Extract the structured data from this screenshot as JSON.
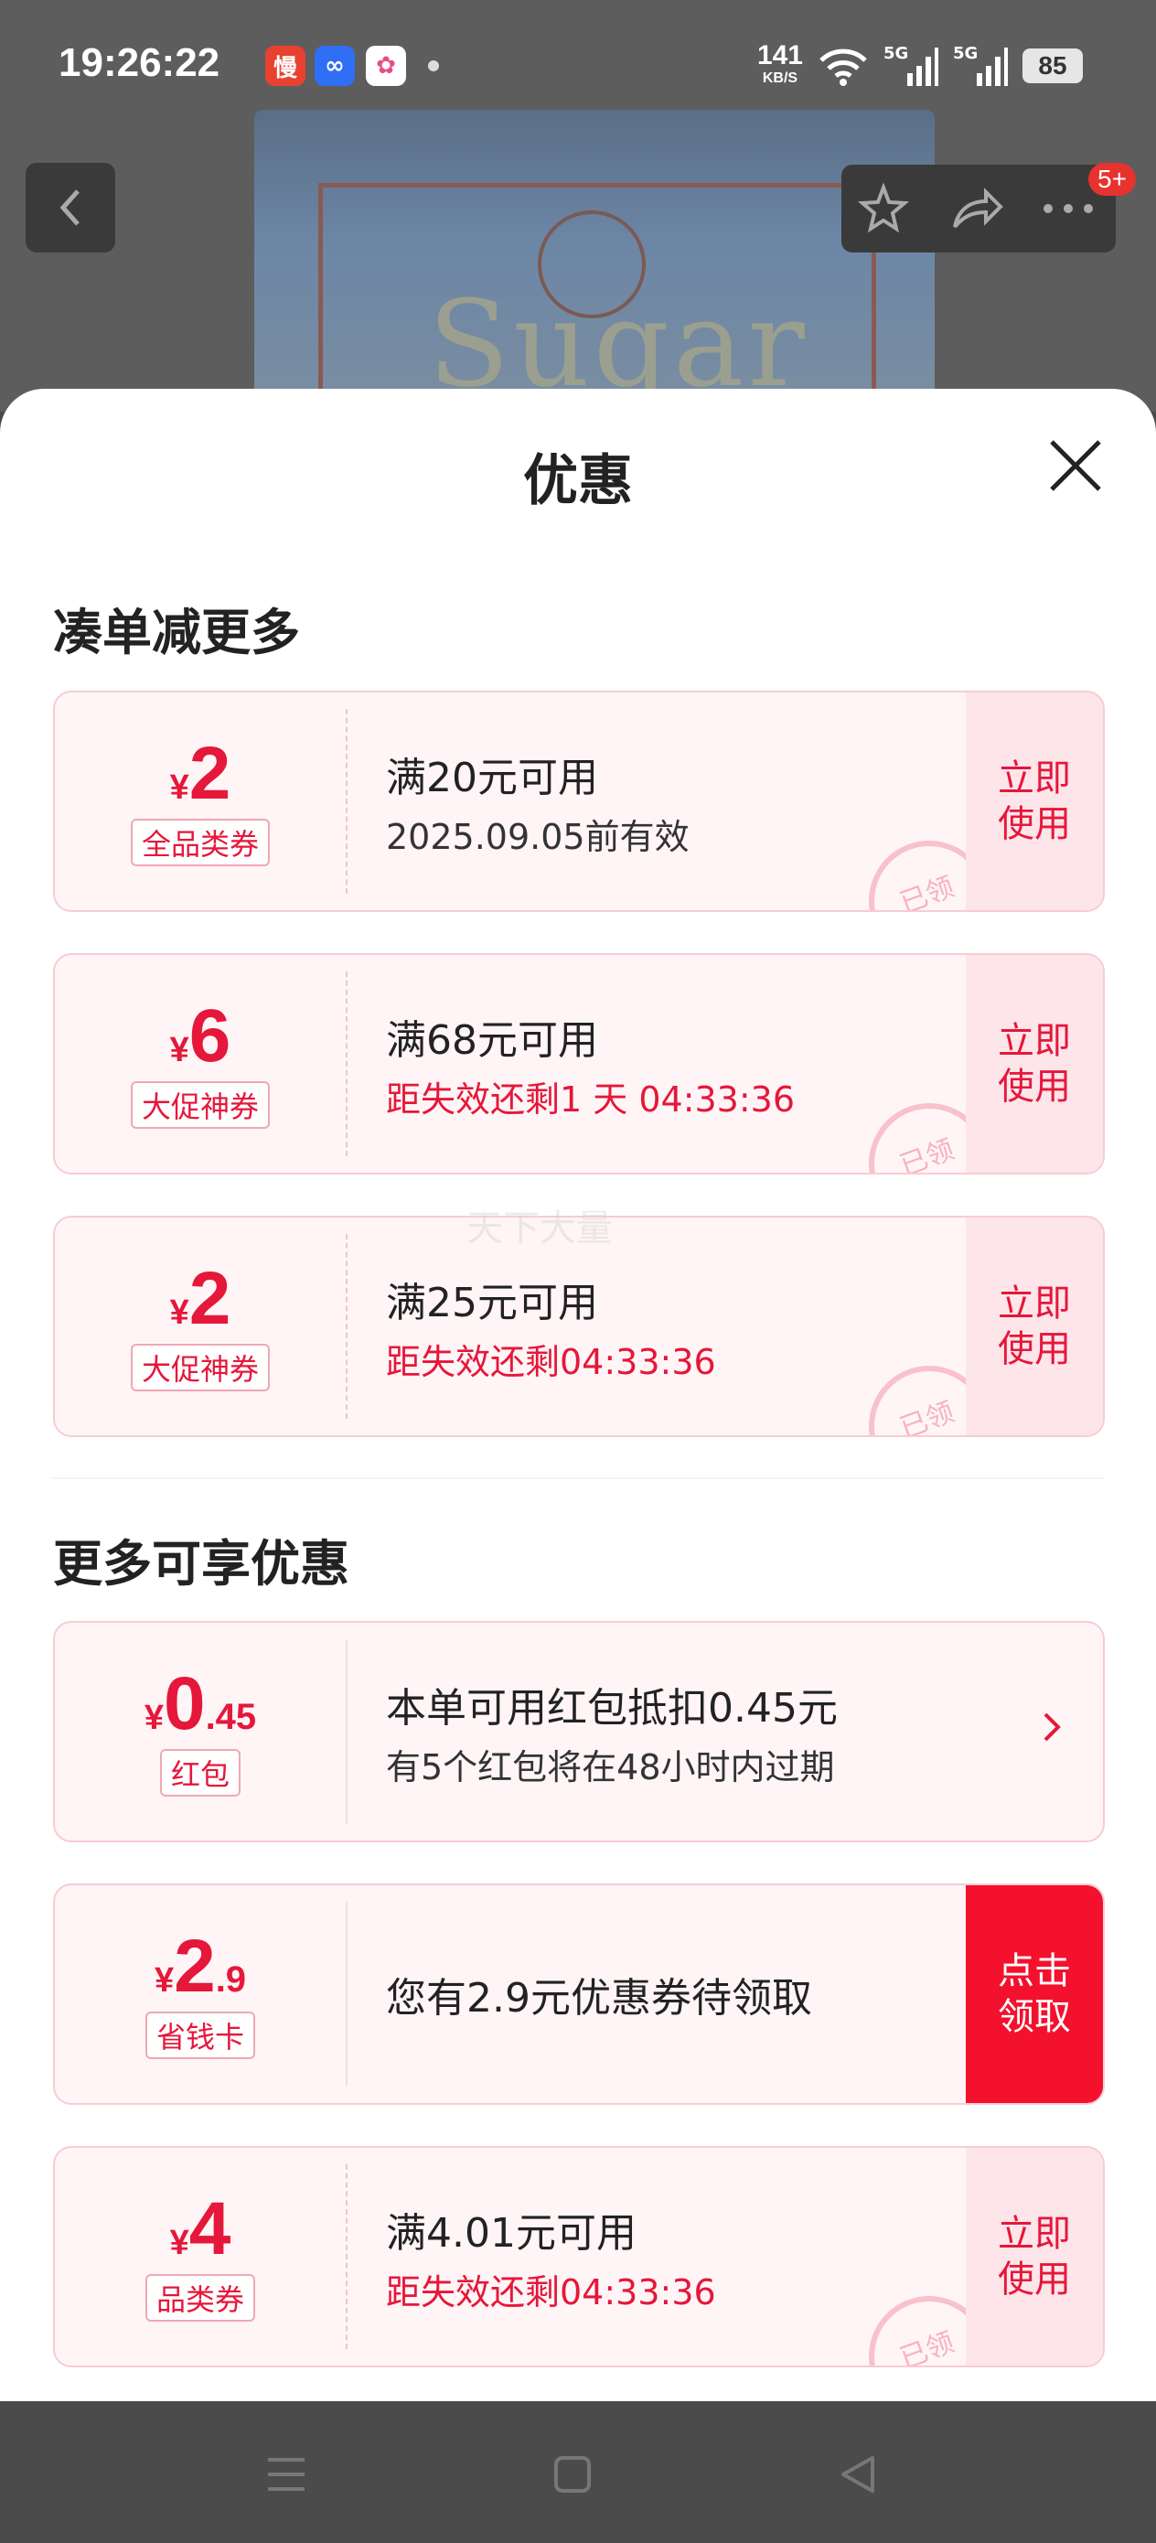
{
  "status_bar": {
    "time": "19:26:22",
    "apps": [
      {
        "name": "manmanmai-app-icon",
        "glyph": "慢",
        "color": "#e8412f"
      },
      {
        "name": "baidu-netdisk-app-icon",
        "glyph": "∞",
        "color": "#2f6ff5"
      },
      {
        "name": "photos-app-icon",
        "glyph": "✿",
        "color": "#ffffff"
      }
    ],
    "net_speed_value": "141",
    "net_speed_unit": "KB/S",
    "signal_1": "5G",
    "signal_2": "5G",
    "battery": "85"
  },
  "header": {
    "cart_badge": "5+",
    "product_word": "Sugar"
  },
  "sheet": {
    "title": "优惠",
    "section1_title": "凑单减更多",
    "section2_title": "更多可享优惠",
    "watermark": "天下大量"
  },
  "coupons": [
    {
      "currency": "¥",
      "amount_int": "2",
      "amount_dec": "",
      "tag": "全品类券",
      "line1": "满20元可用",
      "line2": "2025.09.05前有效",
      "line2_red": false,
      "action": "立即使用",
      "action_type": "use",
      "stamp": "已领"
    },
    {
      "currency": "¥",
      "amount_int": "6",
      "amount_dec": "",
      "tag": "大促神券",
      "line1": "满68元可用",
      "line2": "距失效还剩1 天 04:33:36",
      "line2_red": true,
      "action": "立即使用",
      "action_type": "use",
      "stamp": "已领"
    },
    {
      "currency": "¥",
      "amount_int": "2",
      "amount_dec": "",
      "tag": "大促神券",
      "line1": "满25元可用",
      "line2": "距失效还剩04:33:36",
      "line2_red": true,
      "action": "立即使用",
      "action_type": "use",
      "stamp": "已领"
    },
    {
      "currency": "¥",
      "amount_int": "0",
      "amount_dec": ".45",
      "tag": "红包",
      "line1": "本单可用红包抵扣0.45元",
      "line2": "有5个红包将在48小时内过期",
      "line2_red": false,
      "action": "",
      "action_type": "arrow",
      "stamp": ""
    },
    {
      "currency": "¥",
      "amount_int": "2",
      "amount_dec": ".9",
      "tag": "省钱卡",
      "line1": "您有2.9元优惠券待领取",
      "line2": "",
      "line2_red": false,
      "action": "点击领取",
      "action_type": "claim",
      "stamp": ""
    },
    {
      "currency": "¥",
      "amount_int": "4",
      "amount_dec": "",
      "tag": "品类券",
      "line1": "满4.01元可用",
      "line2": "距失效还剩04:33:36",
      "line2_red": true,
      "action": "立即使用",
      "action_type": "use",
      "stamp": "已领"
    }
  ],
  "colors": {
    "accent": "#e5173a",
    "claim_bg": "#f4112d",
    "coupon_bg": "#fff5f6"
  }
}
